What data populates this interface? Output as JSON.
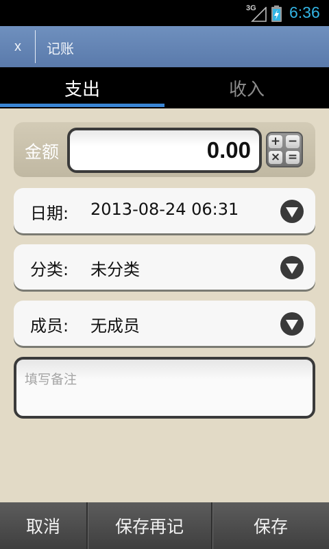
{
  "status_bar": {
    "network": "3G",
    "time": "6:36",
    "time_color": "#33b5e5",
    "icons": [
      "signal-icon",
      "battery-charging-icon"
    ]
  },
  "titlebar": {
    "close_label": "x",
    "title": "记账",
    "background": "#5f80b2"
  },
  "tabs": {
    "items": [
      {
        "label": "支出",
        "selected": true
      },
      {
        "label": "收入",
        "selected": false
      }
    ],
    "indicator_color": "#3a86d5"
  },
  "amount": {
    "label": "金额",
    "value": "0.00",
    "calculator_keys": [
      "+",
      "−",
      "×",
      "="
    ]
  },
  "fields": {
    "date": {
      "label": "日期:",
      "value": "2013-08-24 06:31"
    },
    "category": {
      "label": "分类:",
      "value": "未分类"
    },
    "member": {
      "label": "成员:",
      "value": "无成员"
    }
  },
  "note": {
    "placeholder": "填写备注",
    "value": ""
  },
  "bottom_bar": {
    "cancel_label": "取消",
    "save_again_label": "保存再记",
    "save_label": "保存"
  }
}
